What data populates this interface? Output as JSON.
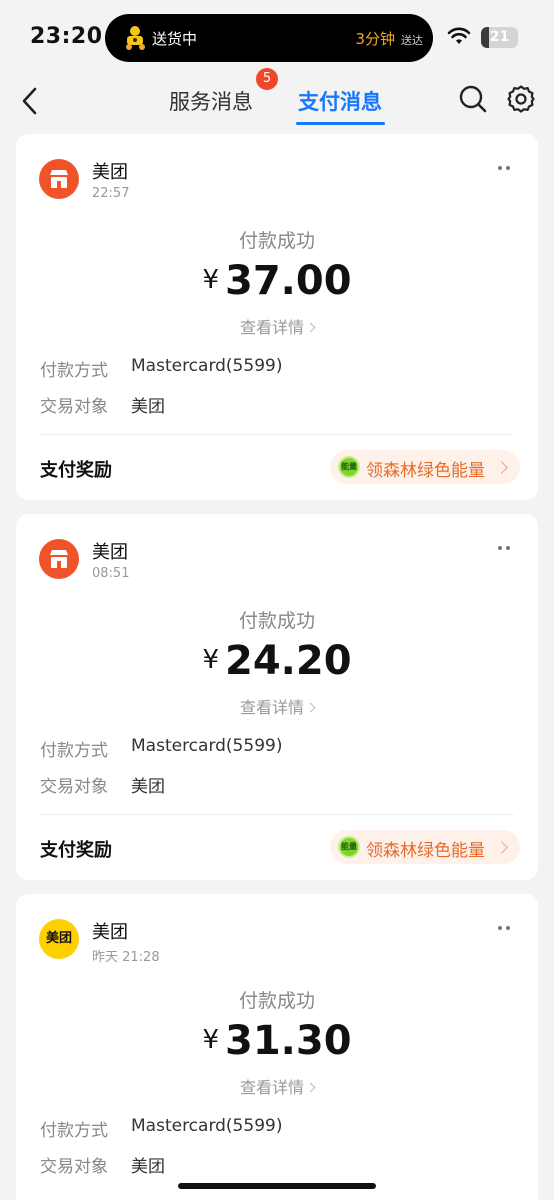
{
  "status_bar": {
    "time": "23:20",
    "island": {
      "status": "送货中",
      "eta": "3分钟",
      "eta_suffix": "送达"
    },
    "battery_level": "21",
    "battery_fraction": 0.21
  },
  "nav": {
    "tabs": [
      {
        "label": "服务消息",
        "badge": "5"
      },
      {
        "label": "支付消息",
        "active": true
      }
    ]
  },
  "cards": [
    {
      "merchant": "美团",
      "time": "22:57",
      "status": "付款成功",
      "currency": "¥",
      "amount": "37.00",
      "detail_link": "查看详情",
      "payment_method_label": "付款方式",
      "payment_method_value": "Mastercard(5599)",
      "counterparty_label": "交易对象",
      "counterparty_value": "美团",
      "reward_label": "支付奖励",
      "reward_text": "领森林绿色能量",
      "energy_badge": "能量"
    },
    {
      "merchant": "美团",
      "time": "08:51",
      "status": "付款成功",
      "currency": "¥",
      "amount": "24.20",
      "detail_link": "查看详情",
      "payment_method_label": "付款方式",
      "payment_method_value": "Mastercard(5599)",
      "counterparty_label": "交易对象",
      "counterparty_value": "美团",
      "reward_label": "支付奖励",
      "reward_text": "领森林绿色能量",
      "energy_badge": "能量"
    },
    {
      "merchant": "美团",
      "time": "昨天 21:28",
      "status": "付款成功",
      "currency": "¥",
      "amount": "31.30",
      "detail_link": "查看详情",
      "payment_method_label": "付款方式",
      "payment_method_value": "Mastercard(5599)",
      "counterparty_label": "交易对象",
      "counterparty_value": "美团",
      "logo_text": "美团"
    }
  ],
  "colors": {
    "accent": "#1677ff",
    "badge": "#f2462b",
    "meituan_orange": "#f0532a",
    "meituan_yellow": "#ffd000",
    "reward_text": "#e96a2a"
  },
  "icons": [
    "back-icon",
    "search-icon",
    "gear-icon",
    "more-icon",
    "wifi-icon",
    "shop-icon",
    "energy-icon"
  ]
}
